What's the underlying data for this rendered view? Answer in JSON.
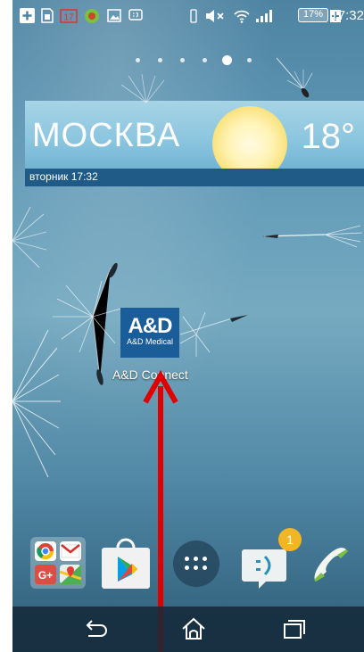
{
  "status_bar": {
    "notification_icons": [
      "add-icon",
      "sim-icon",
      "calendar-icon",
      "game-icon",
      "gallery-icon",
      "message-icon"
    ],
    "calendar_day": "17",
    "system_icons": [
      "vibrate-icon",
      "mute-icon",
      "wifi-icon",
      "signal-icon"
    ],
    "battery_level": "17%",
    "clock": "17:32"
  },
  "home_screens": {
    "count": 6,
    "active_index": 4
  },
  "weather_widget": {
    "city": "МОСКВА",
    "temperature": "18°",
    "date_time": "вторник 17:32"
  },
  "app_icon": {
    "logo_text": "A&D",
    "subtitle": "A&D Medical",
    "label": "A&D Connect"
  },
  "annotation": {
    "arrow_color": "#e00000"
  },
  "dock": {
    "folder_apps": [
      "chrome-icon",
      "gmail-icon",
      "google-plus-icon",
      "maps-icon"
    ],
    "play_store_icon": "play-store-icon",
    "apps_button_icon": "apps-grid-icon",
    "messaging_badge": "1",
    "phone_icon": "phone-icon"
  },
  "nav_bar": {
    "buttons": [
      "back-icon",
      "home-icon",
      "recents-icon"
    ]
  },
  "colors": {
    "widget_bar": "#1f5b86",
    "app_icon_bg": "#1b5d99",
    "badge": "#f1b526"
  }
}
